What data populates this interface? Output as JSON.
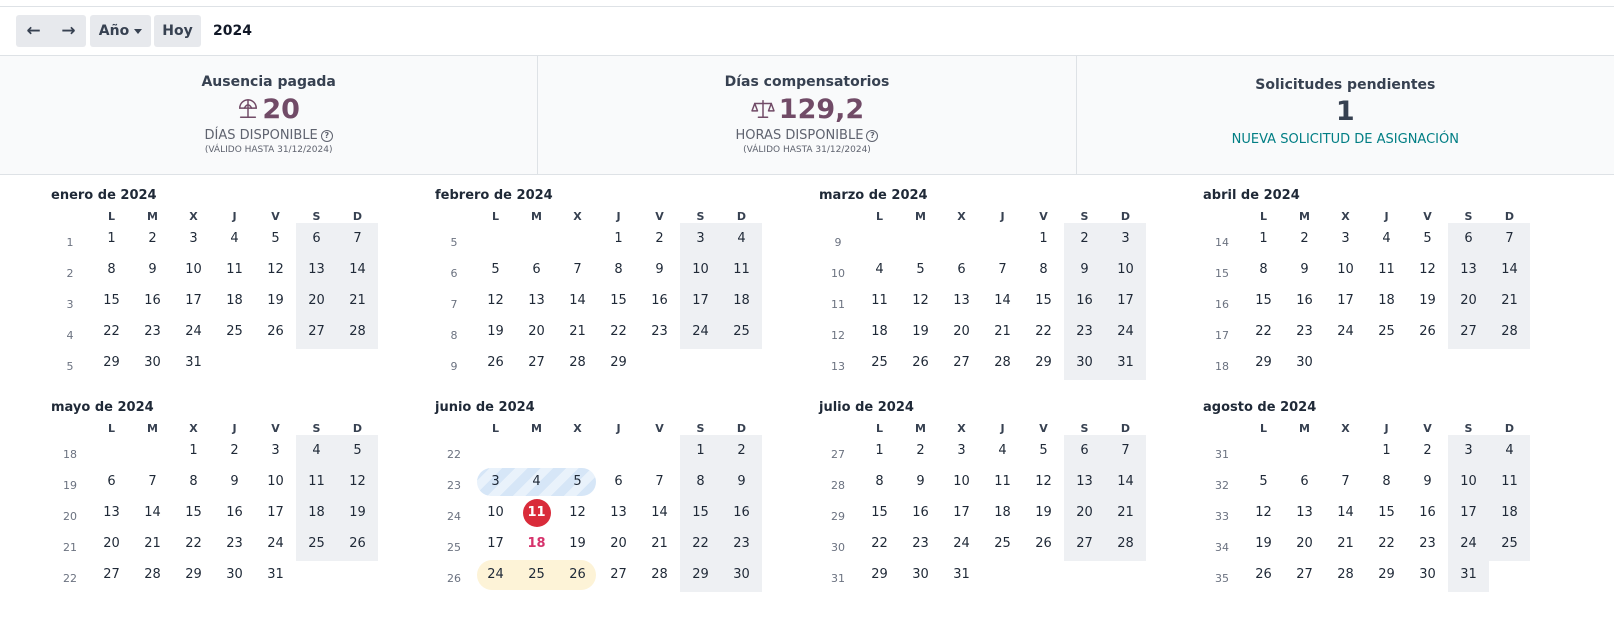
{
  "toolbar": {
    "prev_icon": "arrow-left-icon",
    "next_icon": "arrow-right-icon",
    "prev_glyph": "←",
    "next_glyph": "→",
    "scale_label": "Año",
    "today_label": "Hoy",
    "current_period": "2024"
  },
  "summary": {
    "cards": [
      {
        "title": "Ausencia pagada",
        "icon": "umbrella-icon",
        "value": "20",
        "unit": "DÍAS DISPONIBLE",
        "valid": "(VÁLIDO HASTA 31/12/2024)"
      },
      {
        "title": "Días compensatorios",
        "icon": "scale-icon",
        "value": "129,2",
        "unit": "HORAS DISPONIBLE",
        "valid": "(VÁLIDO HASTA 31/12/2024)"
      }
    ],
    "pending": {
      "title": "Solicitudes pendientes",
      "count": "1",
      "link": "NUEVA SOLICITUD DE ASIGNACIÓN"
    },
    "help_glyph": "?"
  },
  "colors": {
    "accent": "#714b67",
    "link": "#017e84",
    "today": "#d92b3a",
    "weekend": "#eef0f3",
    "stripe": "#d6e6f7",
    "yellow": "#fdf3d7"
  },
  "weekdays": [
    "L",
    "M",
    "X",
    "J",
    "V",
    "S",
    "D"
  ],
  "months": [
    {
      "title": "enero de 2024",
      "weeks": [
        "1",
        "2",
        "3",
        "4",
        "5"
      ],
      "first_dow": 0,
      "days": 31
    },
    {
      "title": "febrero de 2024",
      "weeks": [
        "5",
        "6",
        "7",
        "8",
        "9"
      ],
      "first_dow": 3,
      "days": 29
    },
    {
      "title": "marzo de 2024",
      "weeks": [
        "9",
        "10",
        "11",
        "12",
        "13"
      ],
      "first_dow": 4,
      "days": 31
    },
    {
      "title": "abril de 2024",
      "weeks": [
        "14",
        "15",
        "16",
        "17",
        "18"
      ],
      "first_dow": 0,
      "days": 30
    },
    {
      "title": "mayo de 2024",
      "weeks": [
        "18",
        "19",
        "20",
        "21",
        "22"
      ],
      "first_dow": 2,
      "days": 31
    },
    {
      "title": "junio de 2024",
      "weeks": [
        "22",
        "23",
        "24",
        "25",
        "26"
      ],
      "first_dow": 5,
      "days": 30,
      "marks": {
        "today": 11,
        "highlight": [
          18
        ],
        "striped": [
          3,
          4,
          5
        ],
        "approved": [
          24,
          25,
          26
        ]
      }
    },
    {
      "title": "julio de 2024",
      "weeks": [
        "27",
        "28",
        "29",
        "30",
        "31"
      ],
      "first_dow": 0,
      "days": 31
    },
    {
      "title": "agosto de 2024",
      "weeks": [
        "31",
        "32",
        "33",
        "34",
        "35"
      ],
      "first_dow": 3,
      "days": 31
    }
  ]
}
